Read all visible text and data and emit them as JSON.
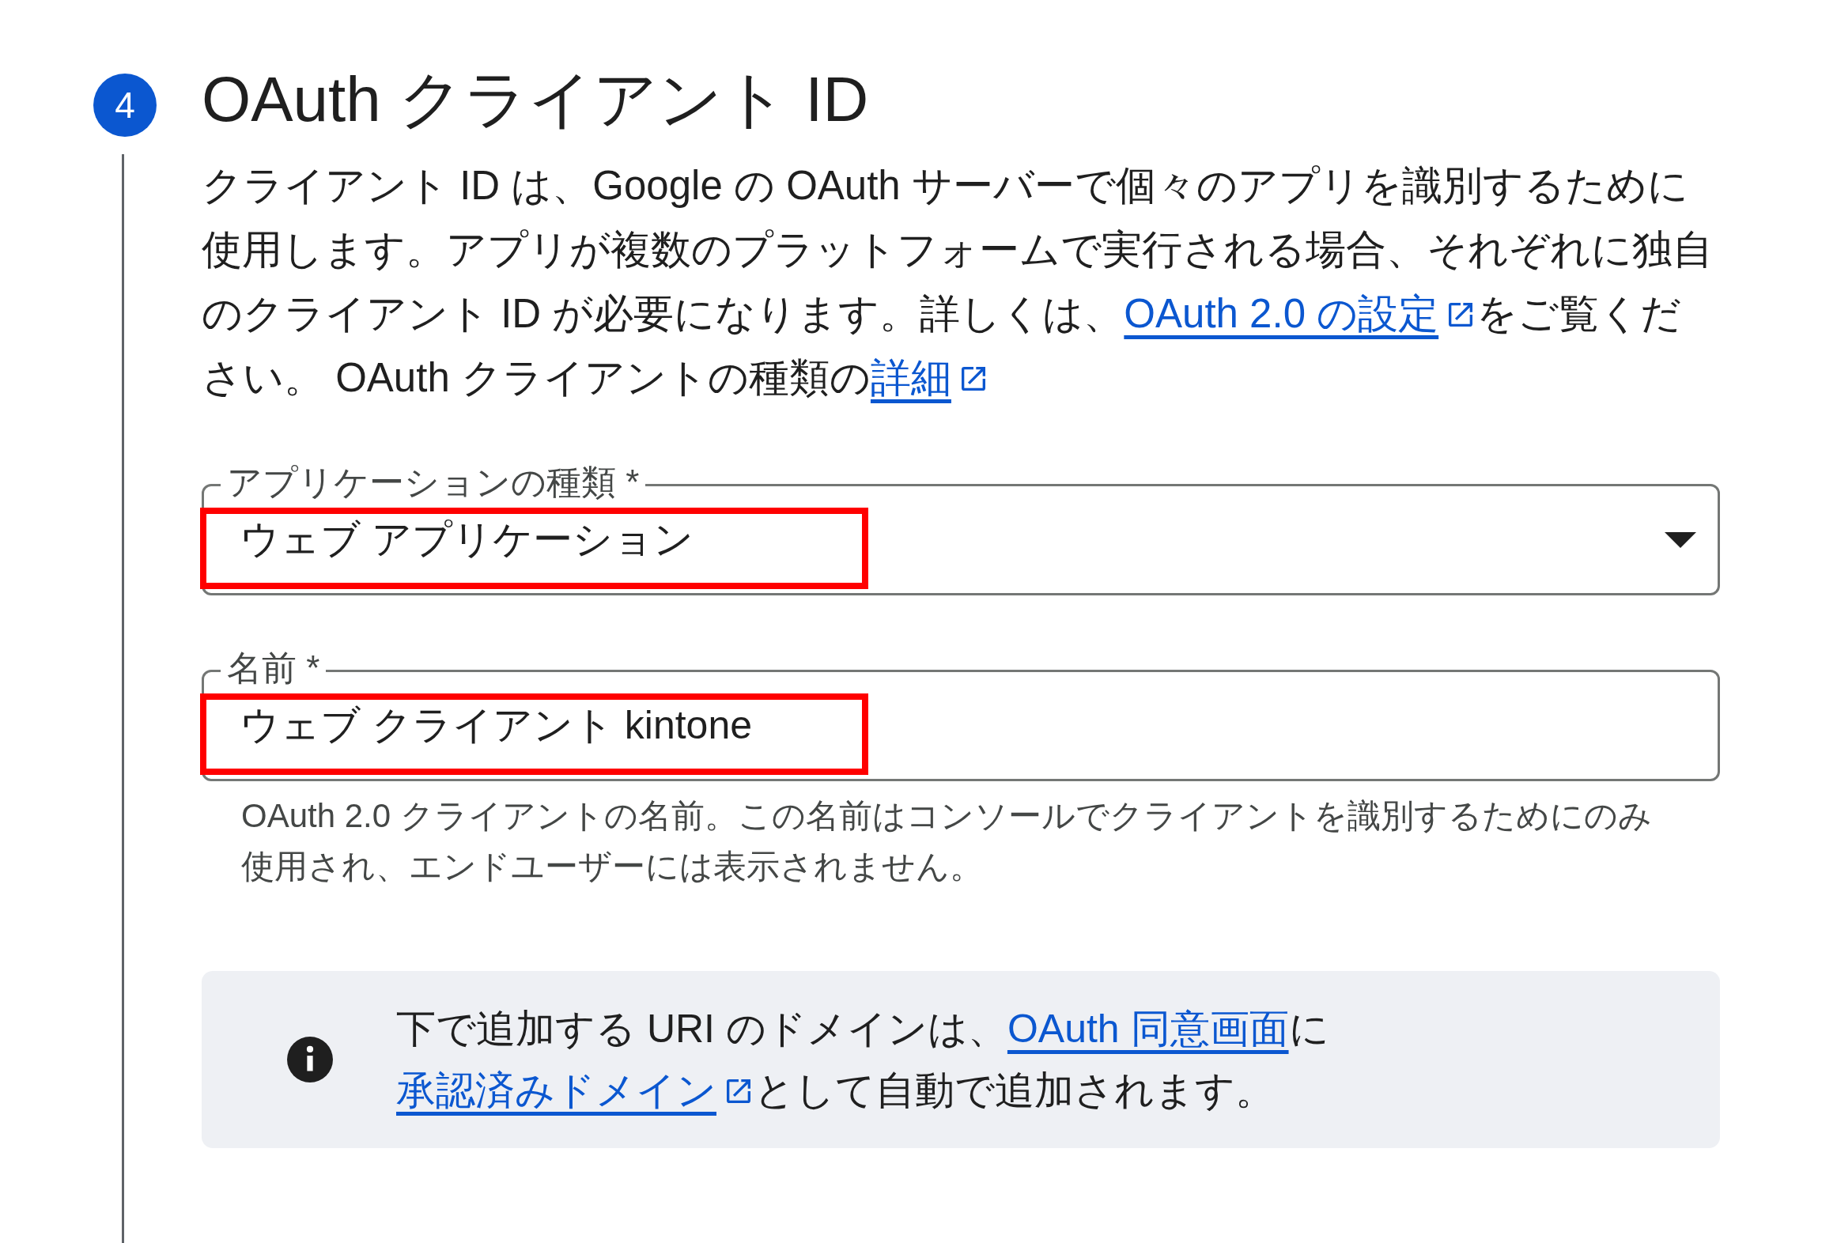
{
  "step": {
    "number": "4",
    "title": "OAuth クライアント ID"
  },
  "description": [
    {
      "kind": "text",
      "text": "クライアント ID は、Google の OAuth サーバーで個々のアプリを識別するために使用します。アプリが複数のプラットフォームで実行される場合、それぞれに独自のクライアント ID が必要になります。詳しくは、"
    },
    {
      "kind": "link",
      "text": "OAuth 2.0 の設定",
      "external": true
    },
    {
      "kind": "text",
      "text": "をご覧ください。 OAuth クライアントの種類の"
    },
    {
      "kind": "link",
      "text": "詳細",
      "external": true
    }
  ],
  "fields": [
    {
      "kind": "select",
      "label": "アプリケーションの種類 *",
      "value": "ウェブ アプリケーション",
      "highlighted": true
    },
    {
      "kind": "text",
      "label": "名前 *",
      "value": "ウェブ クライアント kintone",
      "highlighted": true,
      "hint": "OAuth 2.0 クライアントの名前。この名前はコンソールでクライアントを識別するためにのみ使用され、エンドユーザーには表示されません。"
    }
  ],
  "info": [
    {
      "kind": "text",
      "text": "下で追加する URI のドメインは、"
    },
    {
      "kind": "link",
      "text": "OAuth 同意画面",
      "external": false
    },
    {
      "kind": "text",
      "text": "に"
    },
    {
      "kind": "link",
      "text": "承認済みドメイン",
      "external": true
    },
    {
      "kind": "text",
      "text": "として自動で追加されます。"
    }
  ]
}
